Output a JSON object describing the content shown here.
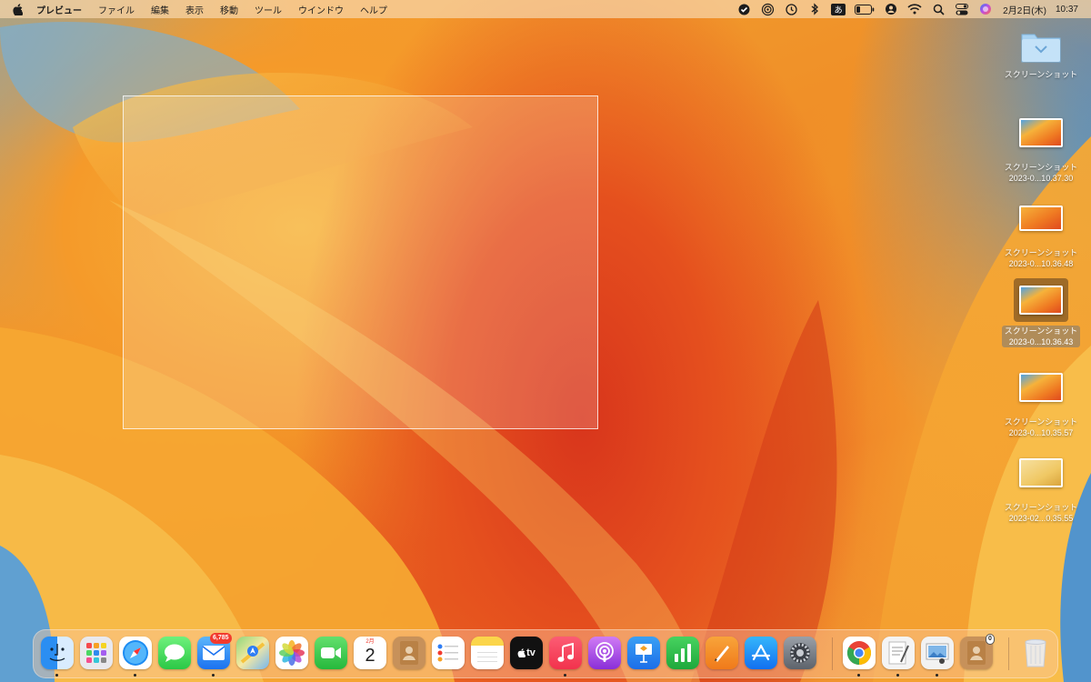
{
  "menubar": {
    "app_name": "プレビュー",
    "menus": [
      "ファイル",
      "編集",
      "表示",
      "移動",
      "ツール",
      "ウインドウ",
      "ヘルプ"
    ],
    "ime_label": "あ",
    "date": "2月2日(木)",
    "time": "10:37"
  },
  "desktop_icons": [
    {
      "name": "スクリーンショット",
      "sub": ""
    },
    {
      "name": "スクリーンショット",
      "sub": "2023-0...10.37.30"
    },
    {
      "name": "スクリーンショット",
      "sub": "2023-0...10.36.48"
    },
    {
      "name": "スクリーンショット",
      "sub": "2023-0...10.36.43"
    },
    {
      "name": "スクリーンショット",
      "sub": "2023-0...10.35.57"
    },
    {
      "name": "スクリーンショット",
      "sub": "2023-02...0.35.55"
    }
  ],
  "dock": {
    "mail_badge": "6,785",
    "calendar_month": "2月",
    "calendar_day": "2",
    "tv_label": "tv",
    "contacts_badge": "0"
  }
}
